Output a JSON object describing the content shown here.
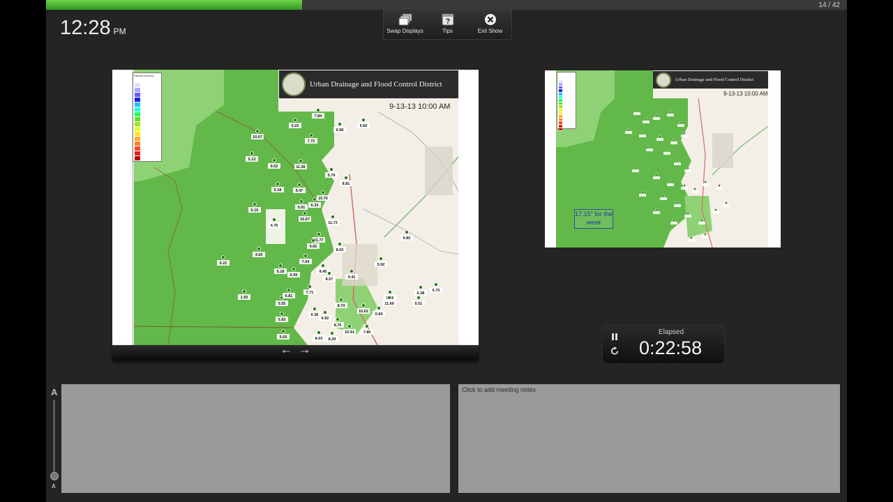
{
  "slide_counter": "14 / 42",
  "slideshow_progress": 0.32,
  "clock": {
    "time": "12:28",
    "ampm": "PM"
  },
  "toolbar": {
    "swap_displays": "Swap Displays",
    "tips": "Tips",
    "exit_show": "Exit Show"
  },
  "current_slide": {
    "title": "Urban Drainage and Flood Control District",
    "date": "9-13-13 10:00 AM",
    "legend_title": "Rainfall (inches)",
    "values": [
      "7.84",
      "5.22",
      "5.60",
      "6.58",
      "10.67",
      "7.72",
      "5.13",
      "9.52",
      "11.56",
      "5.79",
      "8.81",
      "5.18",
      "9.47",
      "10.76",
      "9.91",
      "6.33",
      "6.10",
      "10.67",
      "11.73",
      "4.75",
      "11.77",
      "9.65",
      "6.82",
      "8.63",
      "4.65",
      "7.04",
      "5.92",
      "6.21",
      "5.18",
      "6.09",
      "8.45",
      "8.57",
      "9.41",
      "7.71",
      "8.74",
      "5.55",
      "1.93",
      "6.81",
      "5.93",
      "6.36",
      "6.92",
      "8.70",
      "10.62",
      "5.03",
      "8.03",
      "8.29",
      "10.91",
      "7.85",
      "9.35",
      "11.69",
      "5.51",
      "6.38",
      "5.84",
      "5.75"
    ]
  },
  "next_slide": {
    "title": "Urban Drainage and Flood Control District",
    "date": "9-13-13 10:00 AM",
    "week_note": "17.15\" for the week"
  },
  "slide_nav": {
    "prev_icon": "arrow-left-icon",
    "next_icon": "arrow-right-icon"
  },
  "timer": {
    "label": "Elapsed",
    "value": "0:22:58"
  },
  "notes": {
    "placeholder": "Click to add meeting notes"
  },
  "font_slider": {
    "large": "A",
    "small": "A"
  },
  "colors": {
    "map_green": "#63b84a",
    "map_dark_green": "#55a83e",
    "progress_green": "#4fbf37",
    "stage": "#242424",
    "notes_bg": "#9a9a9a"
  }
}
